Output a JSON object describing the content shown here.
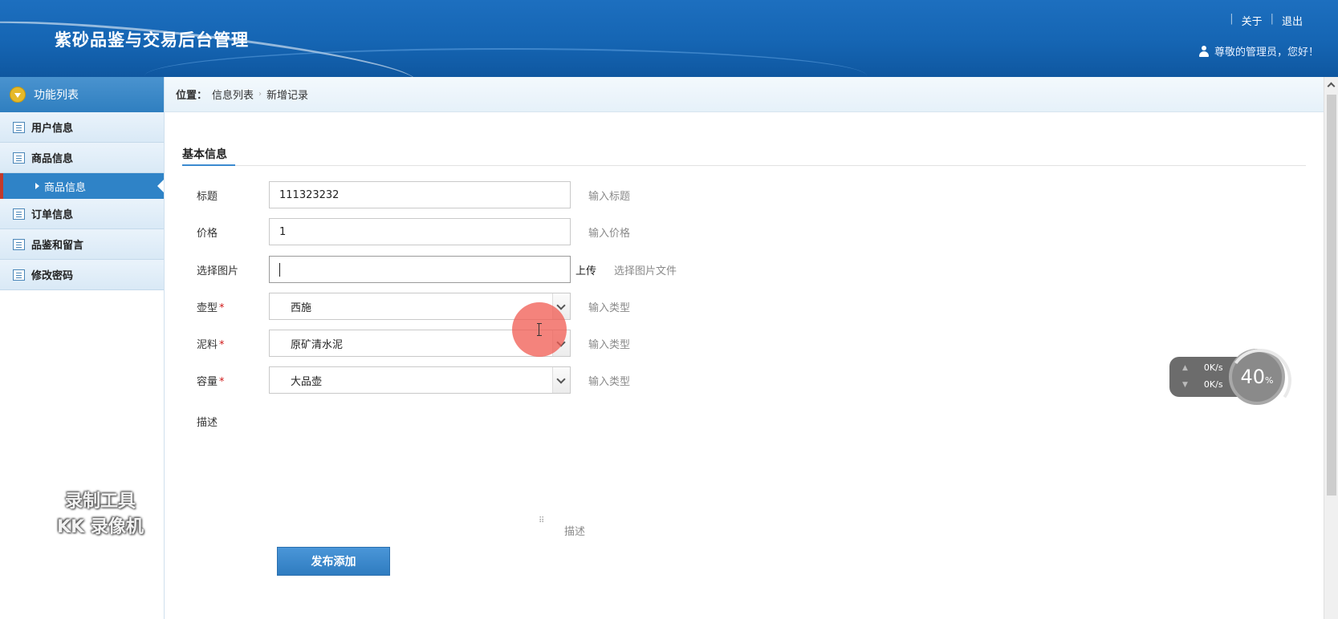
{
  "header": {
    "title": "紫砂品鉴与交易后台管理",
    "links": [
      "关于",
      "退出"
    ],
    "welcome": "尊敬的管理员，您好！"
  },
  "sidebar": {
    "title": "功能列表",
    "items": [
      {
        "label": "用户信息"
      },
      {
        "label": "商品信息"
      },
      {
        "label": "商品信息",
        "sub": true,
        "active": true
      },
      {
        "label": "订单信息"
      },
      {
        "label": "品鉴和留言"
      },
      {
        "label": "修改密码"
      }
    ]
  },
  "breadcrumb": {
    "prefix": "位置：",
    "items": [
      "信息列表",
      "新增记录"
    ]
  },
  "section_title": "基本信息",
  "form": {
    "title": {
      "label": "标题",
      "value": "111323232",
      "hint": "输入标题"
    },
    "price": {
      "label": "价格",
      "value": "1",
      "hint": "输入价格"
    },
    "image": {
      "label": "选择图片",
      "value": "",
      "upload_label": "上传",
      "hint": "选择图片文件"
    },
    "pot_type": {
      "label": "壶型",
      "value": "西施",
      "hint": "输入类型"
    },
    "clay": {
      "label": "泥料",
      "value": "原矿清水泥",
      "hint": "输入类型"
    },
    "capacity": {
      "label": "容量",
      "value": "大品壶",
      "hint": "输入类型"
    },
    "description": {
      "label": "描述",
      "hint": "描述"
    },
    "submit_label": "发布添加"
  },
  "watermark": [
    "录制工具",
    "KK 录像机"
  ],
  "speed_widget": {
    "up": "0K/s",
    "down": "0K/s",
    "percent": "40",
    "unit": "%"
  }
}
